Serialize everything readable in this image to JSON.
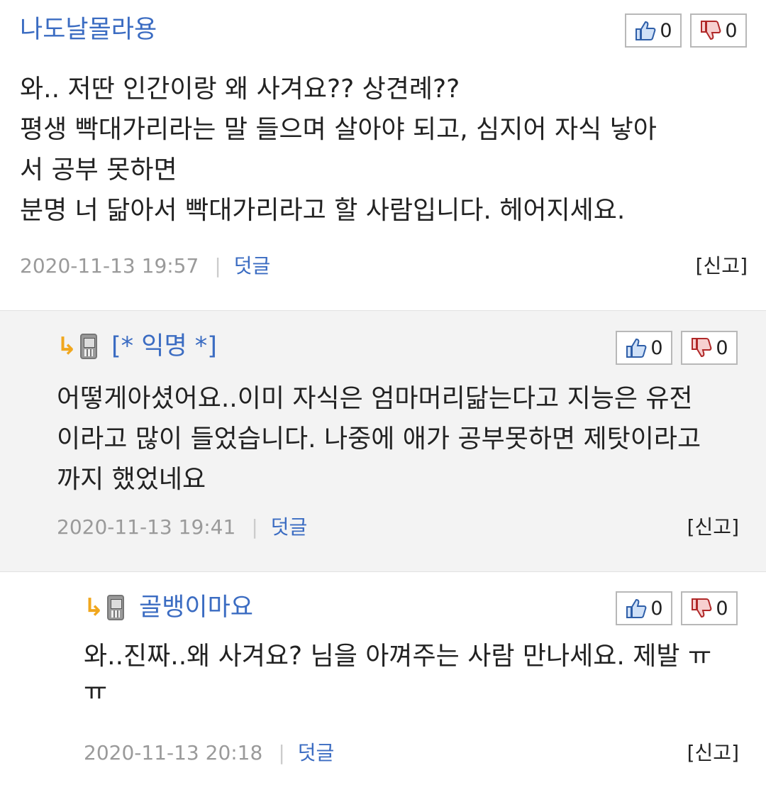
{
  "comments": [
    {
      "author": "나도날몰라용",
      "likes": "0",
      "dislikes": "0",
      "body": "와.. 저딴 인간이랑 왜 사겨요?? 상견례??\n평생 빡대가리라는 말 들으며 살아야 되고, 심지어 자식 낳아\n서 공부 못하면\n분명 너 닮아서 빡대가리라고 할 사람입니다. 헤어지세요.",
      "date": "2020-11-13 19:57",
      "reply_label": "덧글",
      "report_label": "[신고]"
    },
    {
      "author": "[* 익명 *]",
      "likes": "0",
      "dislikes": "0",
      "body": "어떻게아셨어요..이미 자식은 엄마머리닮는다고 지능은 유전\n이라고 많이 들었습니다. 나중에 애가 공부못하면 제탓이라고\n까지 했었네요",
      "date": "2020-11-13 19:41",
      "reply_label": "덧글",
      "report_label": "[신고]"
    },
    {
      "author": "골뱅이마요",
      "likes": "0",
      "dislikes": "0",
      "body": "와..진짜..왜 사겨요? 님을 아껴주는 사람 만나세요.  제발 ㅠ\nㅠ",
      "date": "2020-11-13 20:18",
      "reply_label": "덧글",
      "report_label": "[신고]"
    }
  ],
  "icons": {
    "reply_arrow": "reply-arrow-icon",
    "mobile": "mobile-phone-icon",
    "like": "thumbs-up-icon",
    "dislike": "thumbs-down-icon"
  },
  "colors": {
    "author": "#3b6cc2",
    "reply_arrow": "#f0a71e",
    "meta": "#9a9a9a",
    "nested_background": "#f3f3f3"
  }
}
